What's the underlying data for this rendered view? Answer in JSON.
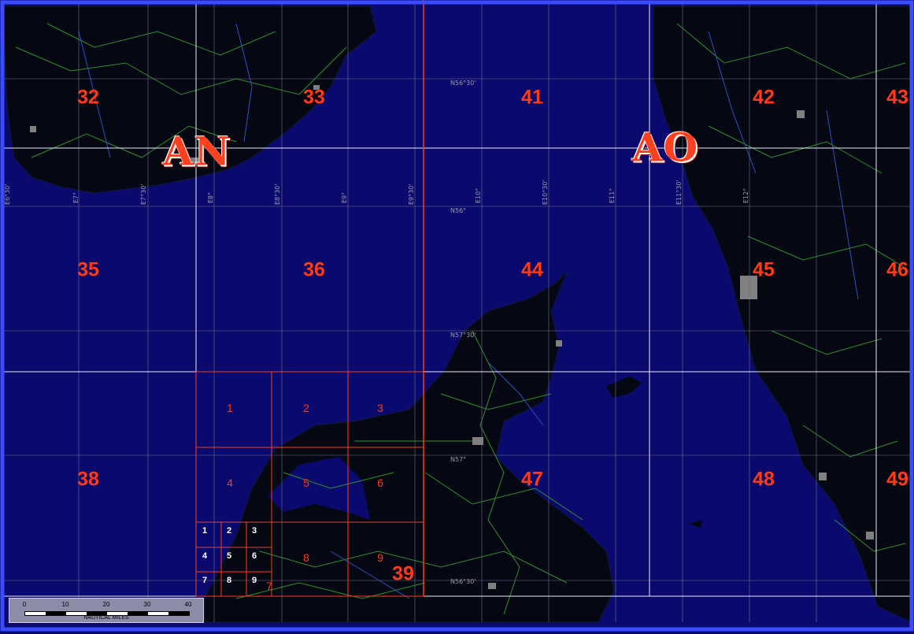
{
  "zones": [
    {
      "label": "AN"
    },
    {
      "label": "AO"
    }
  ],
  "cells": {
    "c32": "32",
    "c33": "33",
    "c41": "41",
    "c42": "42",
    "c43": "43",
    "c35": "35",
    "c36": "36",
    "c44": "44",
    "c45": "45",
    "c46": "46",
    "c38": "38",
    "c39": "39",
    "c47": "47",
    "c48": "48",
    "c49": "49"
  },
  "subcells": [
    "1",
    "2",
    "3",
    "4",
    "5",
    "6",
    "7",
    "8",
    "9"
  ],
  "subsubcells": [
    "1",
    "2",
    "3",
    "4",
    "5",
    "6",
    "7",
    "8",
    "9"
  ],
  "coords": {
    "lat_5630": "N56°30'",
    "lat_56": "N56°",
    "lat_5730": "N57°30'",
    "lat_57": "N57°",
    "lat_5830": "N56°30'",
    "lon_e630": "E6°30'",
    "lon_e7": "E7°",
    "lon_e730": "E7°30'",
    "lon_e8": "E8°",
    "lon_e830": "E8°30'",
    "lon_e9": "E9°",
    "lon_e930": "E9°30'",
    "lon_e10": "E10°",
    "lon_e1030": "E10°30'",
    "lon_e11": "E11°",
    "lon_e1130": "E11°30'",
    "lon_e12": "E12°"
  },
  "scale": {
    "ticks": [
      "0",
      "10",
      "20",
      "30",
      "40"
    ],
    "unit": "NAUTICAL MILES"
  },
  "colors": {
    "sea": "#0a0a6e",
    "land": "#050812",
    "roads": "#2f8f2f",
    "rivers": "#3050c0",
    "grid_major": "#e8e8ff",
    "zone_border": "#ff3a18",
    "labels": "#ff3a18"
  }
}
